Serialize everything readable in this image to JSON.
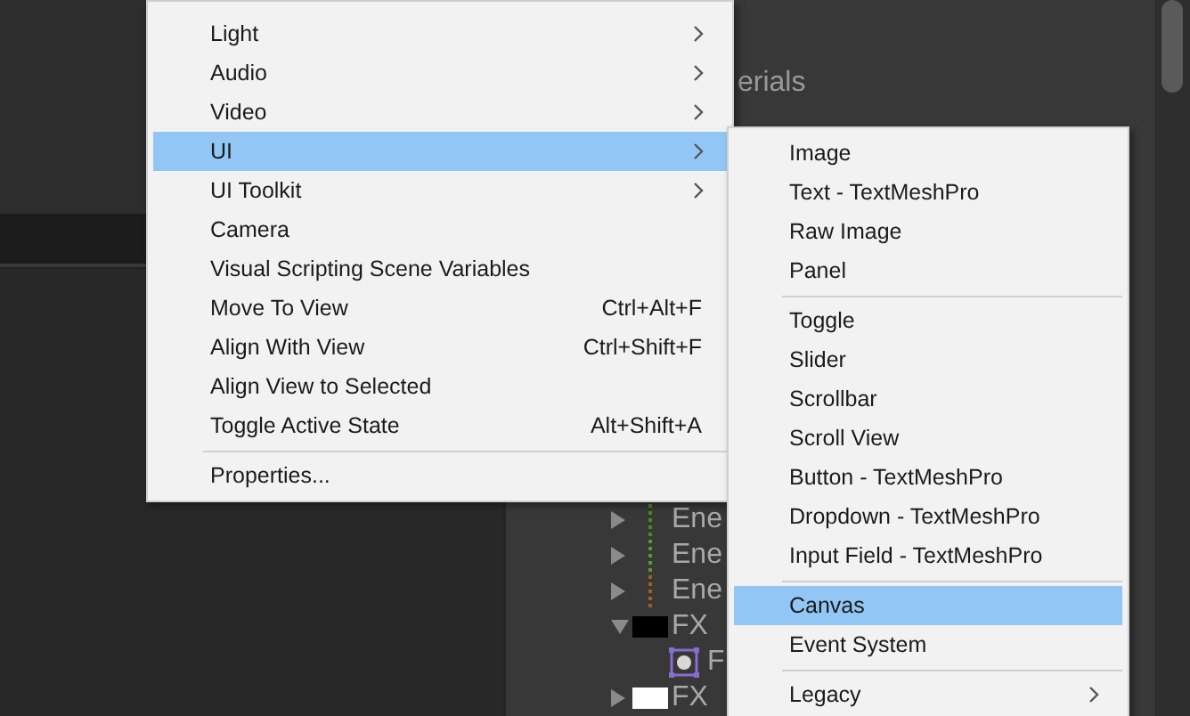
{
  "background_panel": {
    "heading": "erials",
    "hierarchy": [
      {
        "label": "Ene",
        "expanded": false,
        "kind": "line",
        "color": "#3f8f1f"
      },
      {
        "label": "Ene",
        "expanded": false,
        "kind": "line",
        "color": "#5a9a2a"
      },
      {
        "label": "Ene",
        "expanded": false,
        "kind": "line",
        "color": "#a0601a"
      },
      {
        "label": "FX",
        "expanded": true,
        "kind": "swatch",
        "color": "#000000",
        "children": [
          {
            "label": "F",
            "kind": "icon"
          }
        ]
      },
      {
        "label": "FX",
        "expanded": false,
        "kind": "swatch",
        "color": "#ffffff"
      }
    ]
  },
  "context_menu": {
    "items": [
      {
        "kind": "item",
        "label": "Light",
        "submenu": true,
        "selected": false
      },
      {
        "kind": "item",
        "label": "Audio",
        "submenu": true,
        "selected": false
      },
      {
        "kind": "item",
        "label": "Video",
        "submenu": true,
        "selected": false
      },
      {
        "kind": "item",
        "label": "UI",
        "submenu": true,
        "selected": true
      },
      {
        "kind": "item",
        "label": "UI Toolkit",
        "submenu": true,
        "selected": false
      },
      {
        "kind": "item",
        "label": "Camera",
        "submenu": false,
        "selected": false
      },
      {
        "kind": "item",
        "label": "Visual Scripting Scene Variables",
        "submenu": false,
        "selected": false
      },
      {
        "kind": "item",
        "label": "Move To View",
        "shortcut": "Ctrl+Alt+F",
        "submenu": false,
        "selected": false
      },
      {
        "kind": "item",
        "label": "Align With View",
        "shortcut": "Ctrl+Shift+F",
        "submenu": false,
        "selected": false
      },
      {
        "kind": "item",
        "label": "Align View to Selected",
        "submenu": false,
        "selected": false
      },
      {
        "kind": "item",
        "label": "Toggle Active State",
        "shortcut": "Alt+Shift+A",
        "submenu": false,
        "selected": false
      },
      {
        "kind": "separator"
      },
      {
        "kind": "item",
        "label": "Properties...",
        "submenu": false,
        "selected": false
      }
    ]
  },
  "submenu": {
    "items": [
      {
        "kind": "item",
        "label": "Image",
        "submenu": false,
        "selected": false
      },
      {
        "kind": "item",
        "label": "Text - TextMeshPro",
        "submenu": false,
        "selected": false
      },
      {
        "kind": "item",
        "label": "Raw Image",
        "submenu": false,
        "selected": false
      },
      {
        "kind": "item",
        "label": "Panel",
        "submenu": false,
        "selected": false
      },
      {
        "kind": "separator"
      },
      {
        "kind": "item",
        "label": "Toggle",
        "submenu": false,
        "selected": false
      },
      {
        "kind": "item",
        "label": "Slider",
        "submenu": false,
        "selected": false
      },
      {
        "kind": "item",
        "label": "Scrollbar",
        "submenu": false,
        "selected": false
      },
      {
        "kind": "item",
        "label": "Scroll View",
        "submenu": false,
        "selected": false
      },
      {
        "kind": "item",
        "label": "Button - TextMeshPro",
        "submenu": false,
        "selected": false
      },
      {
        "kind": "item",
        "label": "Dropdown - TextMeshPro",
        "submenu": false,
        "selected": false
      },
      {
        "kind": "item",
        "label": "Input Field - TextMeshPro",
        "submenu": false,
        "selected": false
      },
      {
        "kind": "separator"
      },
      {
        "kind": "item",
        "label": "Canvas",
        "submenu": false,
        "selected": true
      },
      {
        "kind": "item",
        "label": "Event System",
        "submenu": false,
        "selected": false
      },
      {
        "kind": "separator"
      },
      {
        "kind": "item",
        "label": "Legacy",
        "submenu": true,
        "selected": false
      }
    ]
  }
}
